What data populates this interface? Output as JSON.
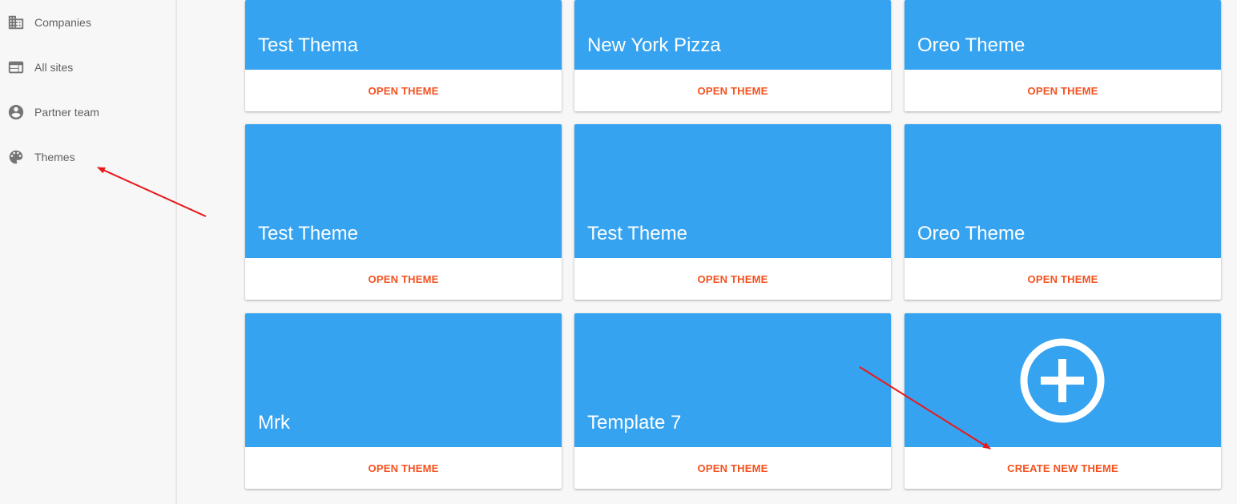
{
  "sidebar": {
    "items": [
      {
        "label": "Companies",
        "icon": "building-icon"
      },
      {
        "label": "All sites",
        "icon": "web-icon"
      },
      {
        "label": "Partner team",
        "icon": "account-circle-icon"
      },
      {
        "label": "Themes",
        "icon": "palette-icon"
      }
    ]
  },
  "themes": [
    {
      "title": "Test Thema",
      "action": "OPEN THEME"
    },
    {
      "title": "New York Pizza",
      "action": "OPEN THEME"
    },
    {
      "title": "Oreo Theme",
      "action": "OPEN THEME"
    },
    {
      "title": "Test Theme",
      "action": "OPEN THEME"
    },
    {
      "title": "Test Theme",
      "action": "OPEN THEME"
    },
    {
      "title": "Oreo Theme",
      "action": "OPEN THEME"
    },
    {
      "title": "Mrk",
      "action": "OPEN THEME"
    },
    {
      "title": "Template 7",
      "action": "OPEN THEME"
    }
  ],
  "create_card": {
    "action": "CREATE NEW THEME",
    "icon": "add-circle-icon"
  },
  "colors": {
    "card_header": "#36a3f0",
    "action_text": "#f4511e",
    "annotation_arrow": "#e8191c"
  }
}
